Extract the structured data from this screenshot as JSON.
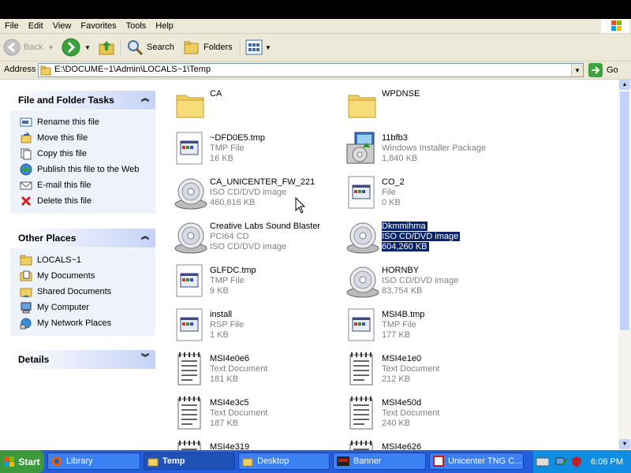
{
  "menu": [
    "File",
    "Edit",
    "View",
    "Favorites",
    "Tools",
    "Help"
  ],
  "toolbar": {
    "back": "Back",
    "search": "Search",
    "folders": "Folders"
  },
  "address": {
    "label": "Address",
    "path": "E:\\DOCUME~1\\Admin\\LOCALS~1\\Temp",
    "go": "Go"
  },
  "tasks_panel": {
    "title": "File and Folder Tasks",
    "items": [
      "Rename this file",
      "Move this file",
      "Copy this file",
      "Publish this file to the Web",
      "E-mail this file",
      "Delete this file"
    ]
  },
  "places_panel": {
    "title": "Other Places",
    "items": [
      "LOCALS~1",
      "My Documents",
      "Shared Documents",
      "My Computer",
      "My Network Places"
    ]
  },
  "details_panel": {
    "title": "Details"
  },
  "files": [
    {
      "name": "CA",
      "type": "",
      "size": "",
      "icon": "folder-icon"
    },
    {
      "name": "WPDNSE",
      "type": "",
      "size": "",
      "icon": "folder-icon"
    },
    {
      "name": "~DFD0E5.tmp",
      "type": "TMP File",
      "size": "16 KB",
      "icon": "file-icon"
    },
    {
      "name": "11bfb3",
      "type": "Windows Installer Package",
      "size": "1,840 KB",
      "icon": "installer-icon"
    },
    {
      "name": "CA_UNICENTER_FW_221",
      "type": "ISO CD/DVD image",
      "size": "460,816 KB",
      "icon": "cd-icon"
    },
    {
      "name": "CO_2",
      "type": "File",
      "size": "0 KB",
      "icon": "file-icon"
    },
    {
      "name": "Creative Labs Sound Blaster",
      "type": "PCI64 CD",
      "size": "ISO CD/DVD image",
      "icon": "cd-icon"
    },
    {
      "name": "Dkmmihma",
      "type": "ISO CD/DVD image",
      "size": "604,260 KB",
      "icon": "cd-icon"
    },
    {
      "name": "GLFDC.tmp",
      "type": "TMP File",
      "size": "9 KB",
      "icon": "file-icon"
    },
    {
      "name": "HORNBY",
      "type": "ISO CD/DVD image",
      "size": "83,754 KB",
      "icon": "cd-icon"
    },
    {
      "name": "install",
      "type": "RSP File",
      "size": "1 KB",
      "icon": "file-icon"
    },
    {
      "name": "MSI4B.tmp",
      "type": "TMP File",
      "size": "177 KB",
      "icon": "file-icon"
    },
    {
      "name": "MSI4e0e6",
      "type": "Text Document",
      "size": "181 KB",
      "icon": "text-doc-icon"
    },
    {
      "name": "MSI4e1e0",
      "type": "Text Document",
      "size": "212 KB",
      "icon": "text-doc-icon"
    },
    {
      "name": "MSI4e3c5",
      "type": "Text Document",
      "size": "187 KB",
      "icon": "text-doc-icon"
    },
    {
      "name": "MSI4e50d",
      "type": "Text Document",
      "size": "240 KB",
      "icon": "text-doc-icon"
    },
    {
      "name": "MSI4e319",
      "type": "",
      "size": "",
      "icon": "text-doc-icon"
    },
    {
      "name": "MSI4e626",
      "type": "",
      "size": "",
      "icon": "text-doc-icon"
    }
  ],
  "selected_file": "Dkmmihma",
  "taskbar": {
    "start": "Start",
    "buttons": [
      "Library",
      "Temp",
      "Desktop",
      "Banner",
      "Unicenter TNG C..."
    ],
    "active": "Temp",
    "clock": "6:06 PM"
  },
  "colors": {
    "selection": "#0a246a",
    "taskbar": "#245edb",
    "start": "#3c9a3c",
    "panel_bg": "#eef2fb"
  }
}
